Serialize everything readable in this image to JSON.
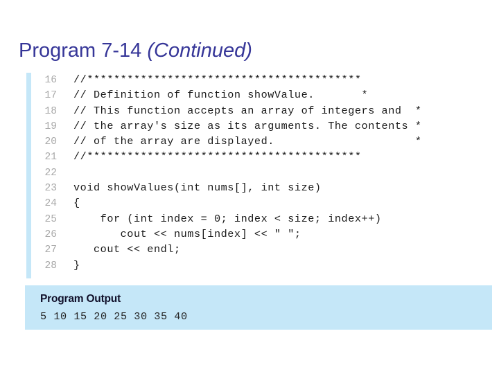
{
  "slide": {
    "title_main": "Program 7-14 ",
    "title_continued": "(Continued)",
    "title_color": "#363698"
  },
  "code_listing": {
    "rule_color": "#c5e7f8",
    "lineno_color": "#a9a9a9",
    "code_color": "#1a1a1a",
    "lines": [
      {
        "no": "16",
        "text": "//*****************************************"
      },
      {
        "no": "17",
        "text": "// Definition of function showValue.       *"
      },
      {
        "no": "18",
        "text": "// This function accepts an array of integers and  *"
      },
      {
        "no": "19",
        "text": "// the array's size as its arguments. The contents *"
      },
      {
        "no": "20",
        "text": "// of the array are displayed.                     *"
      },
      {
        "no": "21",
        "text": "//*****************************************"
      },
      {
        "no": "22",
        "text": ""
      },
      {
        "no": "23",
        "text": "void showValues(int nums[], int size)"
      },
      {
        "no": "24",
        "text": "{"
      },
      {
        "no": "25",
        "text": "    for (int index = 0; index < size; index++)"
      },
      {
        "no": "26",
        "text": "       cout << nums[index] << \" \";"
      },
      {
        "no": "27",
        "text": "   cout << endl;"
      },
      {
        "no": "28",
        "text": "}"
      }
    ]
  },
  "program_output": {
    "heading": "Program Output",
    "text": "5 10 15 20 25 30 35 40",
    "background_color": "#c5e7f8"
  }
}
